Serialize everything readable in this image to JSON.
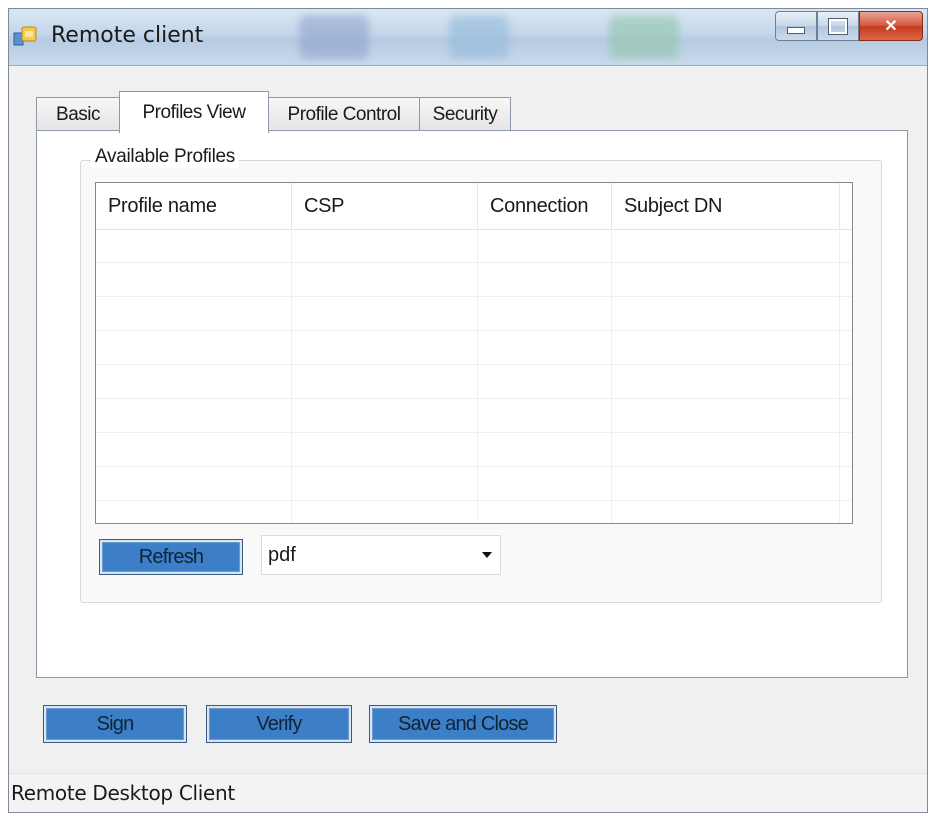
{
  "window": {
    "title": "Remote client",
    "minimize_glyph": "—",
    "maximize_glyph": "□",
    "close_glyph": "✕"
  },
  "tabs": [
    {
      "label": "Basic",
      "active": false
    },
    {
      "label": "Profiles View",
      "active": true
    },
    {
      "label": "Profile Control",
      "active": false
    },
    {
      "label": "Security",
      "active": false
    }
  ],
  "profiles_group": {
    "label": "Available Profiles",
    "columns": [
      "Profile name",
      "CSP",
      "Connection",
      "Subject DN"
    ],
    "rows": []
  },
  "refresh_button": {
    "label": "Refresh"
  },
  "format_combo": {
    "value": "pdf",
    "icon": "chevron-down-icon"
  },
  "actions": {
    "sign_label": "Sign",
    "verify_label": "Verify",
    "save_close_label": "Save and Close"
  },
  "status": {
    "text": "Remote Desktop Client"
  },
  "colors": {
    "button_fill": "#3c7fc6",
    "titlebar": "#c3d6ea",
    "close_button": "#d4553c"
  }
}
